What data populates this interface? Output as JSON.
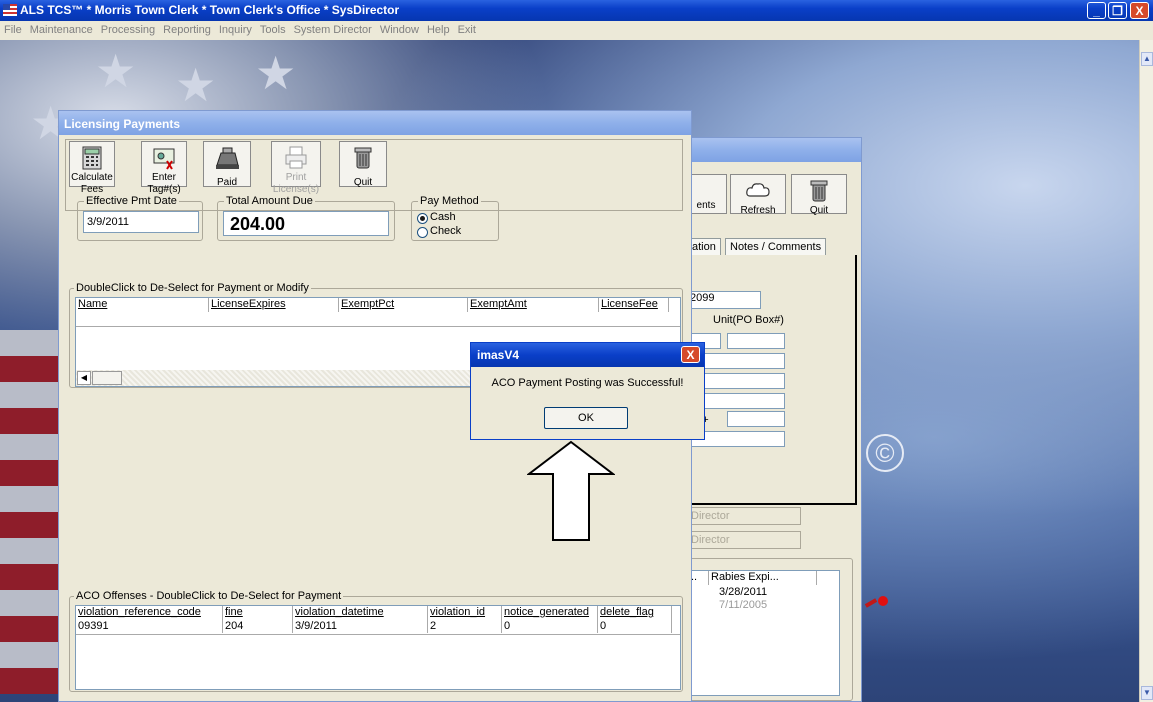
{
  "app": {
    "title": "ALS TCS™ * Morris Town Clerk * Town Clerk's Office * SysDirector",
    "window_controls": {
      "minimize": "_",
      "restore": "❒",
      "close": "X"
    }
  },
  "menu": [
    "File",
    "Maintenance",
    "Processing",
    "Reporting",
    "Inquiry",
    "Tools",
    "System Director",
    "Window",
    "Help",
    "Exit"
  ],
  "licensing": {
    "title": "Licensing Payments",
    "toolbar": [
      {
        "label1": "Calculate",
        "label2": "Fees",
        "icon": "calculator-icon",
        "enabled": true
      },
      {
        "label1": "Enter",
        "label2": "Tag#(s)",
        "icon": "tag-icon",
        "enabled": true
      },
      {
        "label1": "Paid",
        "label2": "",
        "icon": "cash-register-icon",
        "enabled": true
      },
      {
        "label1": "Print",
        "label2": "License(s)",
        "icon": "printer-icon",
        "enabled": false
      },
      {
        "label1": "Quit",
        "label2": "",
        "icon": "trash-can-icon",
        "enabled": true
      }
    ],
    "effective_pmt_date_label": "Effective Pmt Date",
    "effective_pmt_date": "3/9/2011",
    "total_amount_due_label": "Total Amount Due",
    "total_amount_due": "204.00",
    "pay_method_label": "Pay Method",
    "pay_methods": [
      {
        "label": "Cash",
        "selected": true
      },
      {
        "label": "Check",
        "selected": false
      }
    ],
    "license_grid_caption": "DoubleClick to De-Select for Payment or Modify",
    "license_columns": [
      "Name",
      "LicenseExpires",
      "ExemptPct",
      "ExemptAmt",
      "LicenseFee"
    ],
    "offense_caption": "ACO Offenses - DoubleClick to De-Select for Payment",
    "offense_columns": [
      "violation_reference_code",
      "fine",
      "violation_datetime",
      "violation_id",
      "notice_generated",
      "delete_flag"
    ],
    "offense_rows": [
      [
        "09391",
        "204",
        "3/9/2011",
        "2",
        "0",
        "0"
      ]
    ]
  },
  "back_window": {
    "buttons": [
      "ents",
      "Refresh",
      "Quit"
    ],
    "tabs": [
      "ation",
      "Notes / Comments"
    ],
    "field_value": "2099",
    "unit_label": "Unit(PO Box#)",
    "zip_label": "Zip+",
    "director1": "Director",
    "director2": "Director",
    "grid_columns": [
      "..",
      "Rabies Expi..."
    ],
    "grid_rows": [
      "3/28/2011",
      "7/11/2005"
    ]
  },
  "message_box": {
    "title": "imasV4",
    "close": "X",
    "message": "ACO Payment Posting was Successful!",
    "ok_label": "OK"
  },
  "desktop_mark": "©"
}
